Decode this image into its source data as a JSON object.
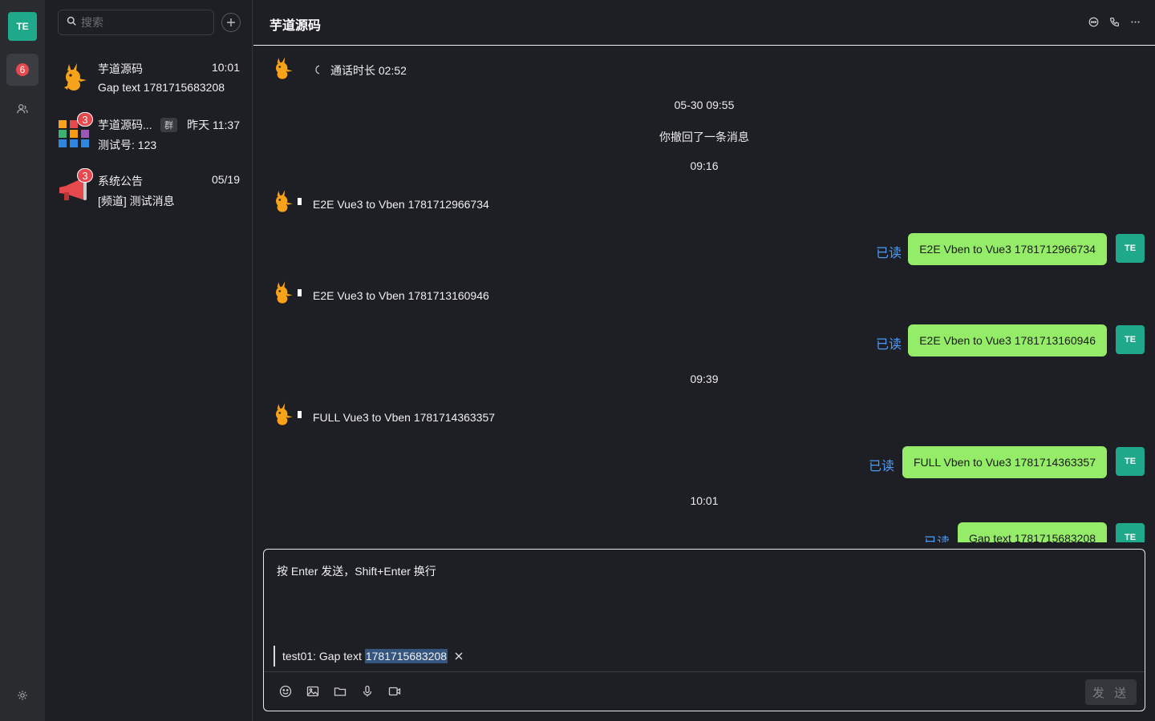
{
  "rail": {
    "user_avatar": "TE",
    "chat_badge": "6",
    "icons": [
      "chat-icon",
      "contacts-icon",
      "settings-icon"
    ]
  },
  "sessions": {
    "search_placeholder": "搜索",
    "items": [
      {
        "name": "芋道源码",
        "time": "10:01",
        "preview": "Gap text 1781715683208",
        "badge": ""
      },
      {
        "name": "芋道源码...",
        "tag": "群",
        "time": "昨天 11:37",
        "preview": "测试号: 123",
        "badge": "3"
      },
      {
        "name": "系统公告",
        "time": "05/19",
        "preview": "[频道] 测试消息",
        "badge": "3"
      }
    ]
  },
  "chat": {
    "title": "芋道源码",
    "messages": [
      {
        "type": "peer-call",
        "text": "通话时长 02:52"
      },
      {
        "type": "time",
        "text": "05-30 09:55"
      },
      {
        "type": "system",
        "text": "你撤回了一条消息"
      },
      {
        "type": "time",
        "text": "09:16"
      },
      {
        "type": "peer",
        "text": "E2E Vue3 to Vben 1781712966734"
      },
      {
        "type": "self",
        "text": "E2E Vben to Vue3 1781712966734",
        "status": "已读",
        "avatar": "TE"
      },
      {
        "type": "peer",
        "text": "E2E Vue3 to Vben 1781713160946"
      },
      {
        "type": "self",
        "text": "E2E Vben to Vue3 1781713160946",
        "status": "已读",
        "avatar": "TE"
      },
      {
        "type": "time",
        "text": "09:39"
      },
      {
        "type": "peer",
        "text": "FULL Vue3 to Vben 1781714363357"
      },
      {
        "type": "self",
        "text": "FULL Vben to Vue3 1781714363357",
        "status": "已读",
        "avatar": "TE"
      },
      {
        "type": "time",
        "text": "10:01"
      },
      {
        "type": "self",
        "text": "Gap text 1781715683208",
        "status": "已读",
        "avatar": "TE"
      }
    ]
  },
  "composer": {
    "placeholder": "按 Enter 发送，Shift+Enter 换行",
    "quote_prefix": "test01:  Gap text",
    "quote_selected": "1781715683208",
    "send_label": "发 送"
  },
  "colors": {
    "accent": "#1fa88a",
    "bubble": "#95ec69",
    "read": "#4e9bf5",
    "badge": "#e5484d"
  }
}
